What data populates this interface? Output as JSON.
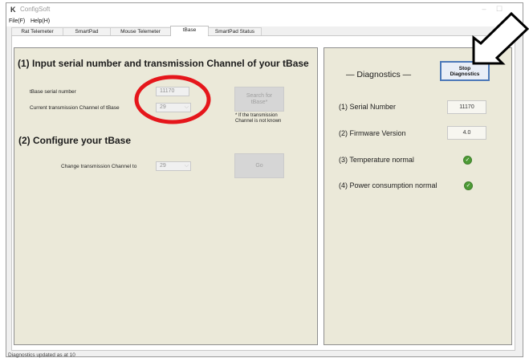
{
  "window": {
    "title": "ConfigSoft",
    "minimize": "–",
    "maximize": "☐"
  },
  "menu": {
    "file": "File(F)",
    "help": "Help(H)"
  },
  "tabs": [
    {
      "label": "Rat Telemeter"
    },
    {
      "label": "SmartPad"
    },
    {
      "label": "Mouse Telemeter"
    },
    {
      "label": "tBase"
    },
    {
      "label": "SmartPad Status"
    }
  ],
  "left": {
    "heading1": "(1) Input serial number and transmission Channel of your tBase",
    "serial_label": "tBase serial number",
    "serial_value": "11170",
    "channel_label": "Current transmission Channel of tBase",
    "channel_value": "29",
    "search_button": "Search for tBase*",
    "note": "* If the transmission Channel is not known",
    "heading2": "(2) Configure your tBase",
    "change_label": "Change transmission Channel to",
    "change_value": "29",
    "go_button": "Go"
  },
  "right": {
    "title": "— Diagnostics —",
    "stop_button": "Stop\nDiagnostics",
    "serial_label": "(1) Serial Number",
    "serial_value": "11170",
    "firmware_label": "(2) Firmware Version",
    "firmware_value": "4.0",
    "temperature_label": "(3) Temperature normal",
    "power_label": "(4) Power consumption normal"
  },
  "status_bar": {
    "text": "Diagnostics updated as at 10"
  },
  "colors": {
    "panel_bg": "#ebe9d9",
    "annotation_red": "#e5161b",
    "check_green": "#4d9b35"
  }
}
